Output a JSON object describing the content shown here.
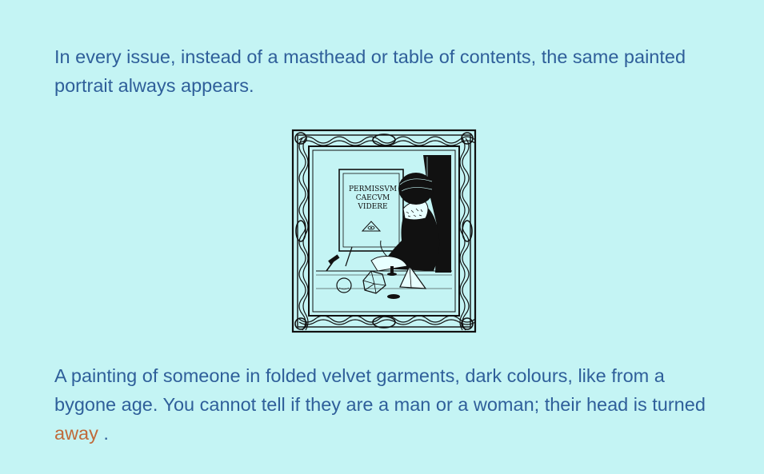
{
  "story": {
    "paragraph_1": "In every issue, instead of a masthead or table of contents, the same painted portrait always appears.",
    "paragraph_2_text": "A painting of someone in folded velvet garments, dark colours, like from a bygone age. You cannot tell if they are a man or a woman; their head is turned ",
    "paragraph_2_link": "away",
    "paragraph_2_end": "."
  },
  "portrait": {
    "inscription_line_1": "PERMISSVM",
    "inscription_line_2": "CAECVM",
    "inscription_line_3": "VIDERE"
  },
  "colors": {
    "background": "#c4f4f4",
    "body_text": "#2f5f9a",
    "link_text": "#c06a3a",
    "ink": "#111111"
  }
}
